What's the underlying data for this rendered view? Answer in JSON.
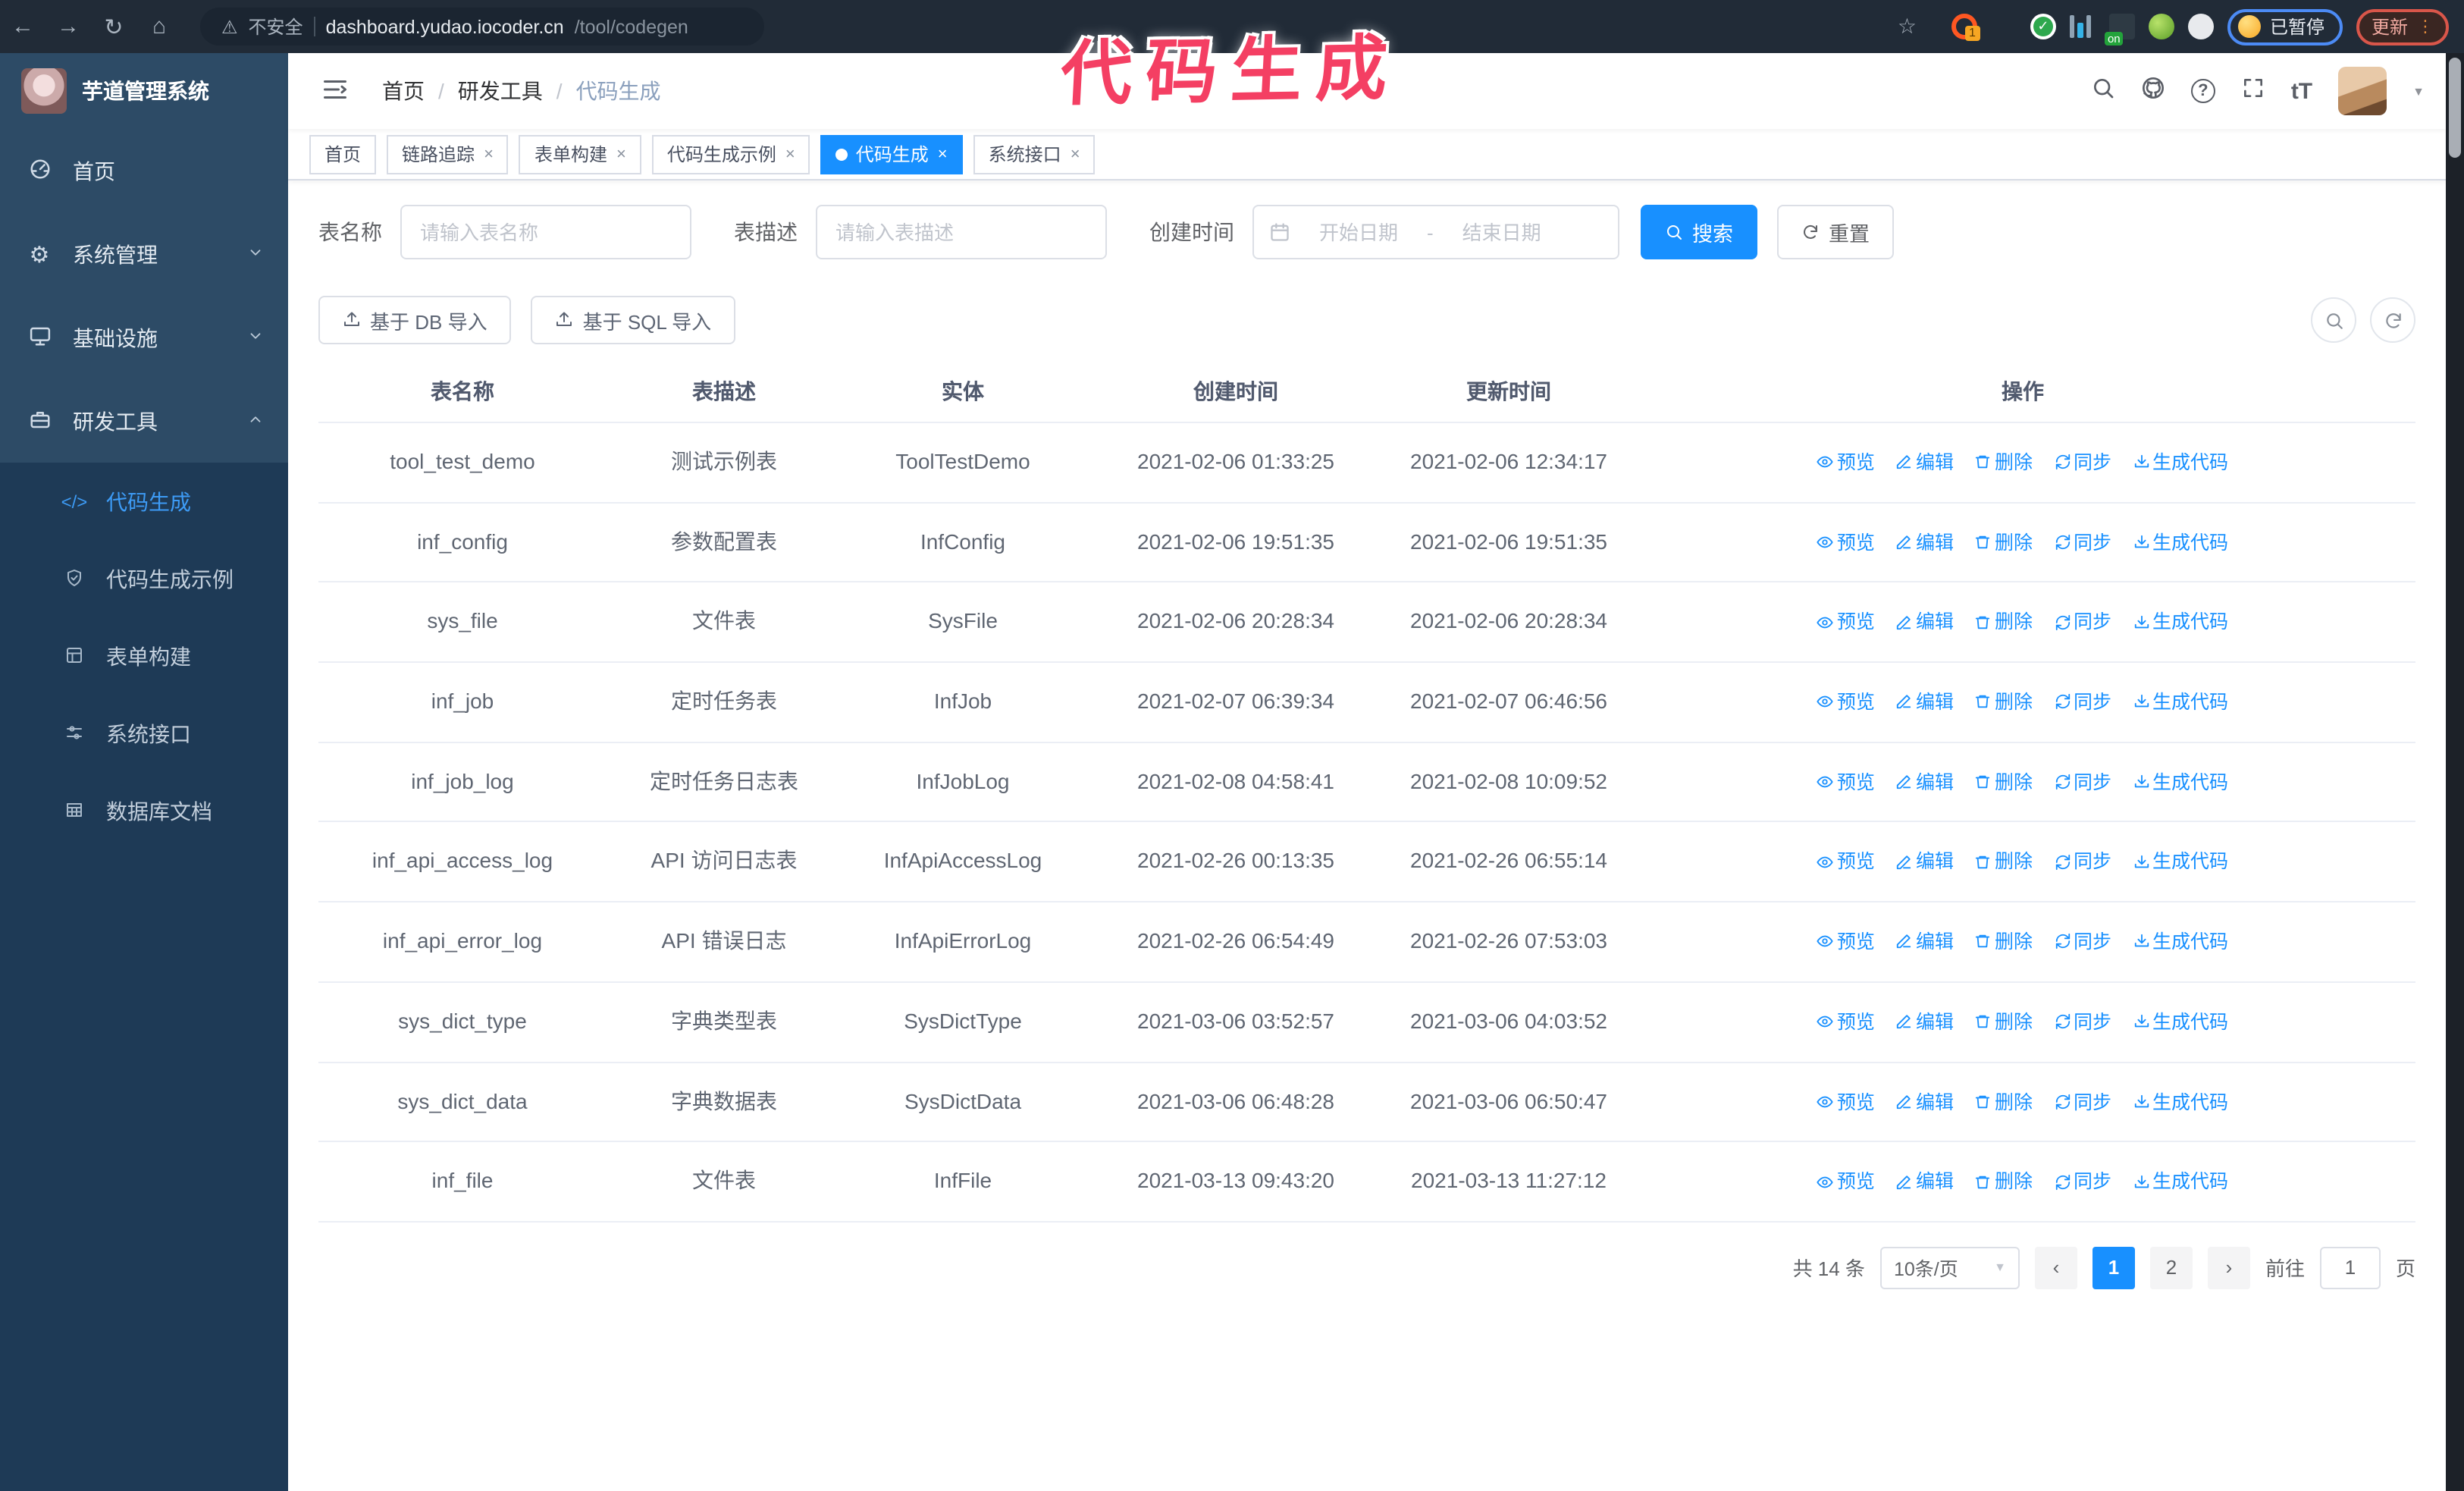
{
  "browser": {
    "secure_warning": "不安全",
    "url_host": "dashboard.yudao.iocoder.cn",
    "url_path": "/tool/codegen",
    "extension_badge_count": "1",
    "extension_badge_on": "on",
    "paused_badge": "已暂停",
    "update_button": "更新"
  },
  "annotation": {
    "text": "代码生成"
  },
  "sidebar": {
    "logo_title": "芋道管理系统",
    "items": [
      {
        "label": "首页"
      },
      {
        "label": "系统管理"
      },
      {
        "label": "基础设施"
      },
      {
        "label": "研发工具"
      }
    ],
    "subitems": [
      {
        "label": "代码生成"
      },
      {
        "label": "代码生成示例"
      },
      {
        "label": "表单构建"
      },
      {
        "label": "系统接口"
      },
      {
        "label": "数据库文档"
      }
    ]
  },
  "header": {
    "breadcrumb": {
      "home": "首页",
      "section": "研发工具",
      "current": "代码生成"
    }
  },
  "tabs": [
    {
      "label": "首页"
    },
    {
      "label": "链路追踪"
    },
    {
      "label": "表单构建"
    },
    {
      "label": "代码生成示例"
    },
    {
      "label": "代码生成"
    },
    {
      "label": "系统接口"
    }
  ],
  "filters": {
    "name_label": "表名称",
    "name_placeholder": "请输入表名称",
    "desc_label": "表描述",
    "desc_placeholder": "请输入表描述",
    "time_label": "创建时间",
    "date_start_placeholder": "开始日期",
    "date_separator": "-",
    "date_end_placeholder": "结束日期",
    "search_button": "搜索",
    "reset_button": "重置"
  },
  "toolbar": {
    "import_db_button": "基于 DB 导入",
    "import_sql_button": "基于 SQL 导入"
  },
  "table": {
    "columns": [
      "表名称",
      "表描述",
      "实体",
      "创建时间",
      "更新时间",
      "操作"
    ],
    "ops": [
      "预览",
      "编辑",
      "删除",
      "同步",
      "生成代码"
    ],
    "rows": [
      {
        "name": "tool_test_demo",
        "desc": "测试示例表",
        "entity": "ToolTestDemo",
        "created": "2021-02-06 01:33:25",
        "updated": "2021-02-06 12:34:17"
      },
      {
        "name": "inf_config",
        "desc": "参数配置表",
        "entity": "InfConfig",
        "created": "2021-02-06 19:51:35",
        "updated": "2021-02-06 19:51:35"
      },
      {
        "name": "sys_file",
        "desc": "文件表",
        "entity": "SysFile",
        "created": "2021-02-06 20:28:34",
        "updated": "2021-02-06 20:28:34"
      },
      {
        "name": "inf_job",
        "desc": "定时任务表",
        "entity": "InfJob",
        "created": "2021-02-07 06:39:34",
        "updated": "2021-02-07 06:46:56"
      },
      {
        "name": "inf_job_log",
        "desc": "定时任务日志表",
        "entity": "InfJobLog",
        "created": "2021-02-08 04:58:41",
        "updated": "2021-02-08 10:09:52"
      },
      {
        "name": "inf_api_access_log",
        "desc": "API 访问日志表",
        "entity": "InfApiAccessLog",
        "created": "2021-02-26 00:13:35",
        "updated": "2021-02-26 06:55:14"
      },
      {
        "name": "inf_api_error_log",
        "desc": "API 错误日志",
        "entity": "InfApiErrorLog",
        "created": "2021-02-26 06:54:49",
        "updated": "2021-02-26 07:53:03"
      },
      {
        "name": "sys_dict_type",
        "desc": "字典类型表",
        "entity": "SysDictType",
        "created": "2021-03-06 03:52:57",
        "updated": "2021-03-06 04:03:52"
      },
      {
        "name": "sys_dict_data",
        "desc": "字典数据表",
        "entity": "SysDictData",
        "created": "2021-03-06 06:48:28",
        "updated": "2021-03-06 06:50:47"
      },
      {
        "name": "inf_file",
        "desc": "文件表",
        "entity": "InfFile",
        "created": "2021-03-13 09:43:20",
        "updated": "2021-03-13 11:27:12"
      }
    ]
  },
  "pagination": {
    "total": "共 14 条",
    "page_size": "10条/页",
    "page_1": "1",
    "page_2": "2",
    "goto_label": "前往",
    "goto_value": "1",
    "goto_suffix": "页"
  },
  "colors": {
    "accent": "#1890ff",
    "sidebar_bg": "#2d4b66",
    "sidebar_sub_bg": "#1e3a56",
    "annotation_pink": "#f43f63"
  },
  "icons": {
    "back": "←",
    "forward": "→",
    "reload": "↻",
    "home": "⌂",
    "warning": "⚠",
    "star": "☆",
    "check": "✓",
    "close": "×",
    "breadcrumb_sep": "/",
    "gear": "⚙",
    "code": "</>",
    "help": "?",
    "font_size": "tT",
    "caret_down": "▼",
    "ellipsis_v": "⋮",
    "prev": "‹",
    "next": "›"
  }
}
